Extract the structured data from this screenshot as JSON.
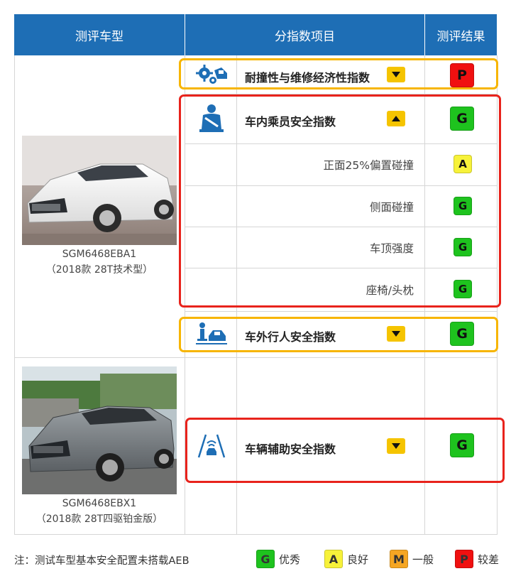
{
  "header": {
    "col_model": "测评车型",
    "col_item": "分指数项目",
    "col_result": "测评结果"
  },
  "colors": {
    "header_blue": "#1e6eb5",
    "grade_G": "#1ec31e",
    "grade_A": "#f7f23a",
    "grade_M": "#f5a623",
    "grade_P": "#f01010",
    "highlight_orange": "#f7b500",
    "highlight_red": "#e8231c",
    "toggle_yellow": "#f5c400"
  },
  "vehicles": [
    {
      "code": "SGM6468EBA1",
      "trim": "（2018款 28T技术型）"
    },
    {
      "code": "SGM6468EBX1",
      "trim": "（2018款 28T四驱铂金版）"
    }
  ],
  "indices": {
    "crash_repair": {
      "icon": "repair-gears-icon",
      "label": "耐撞性与维修经济性指数",
      "toggle": "collapsed",
      "grade": "P"
    },
    "occupant": {
      "icon": "seated-occupant-icon",
      "label": "车内乘员安全指数",
      "toggle": "expanded",
      "grade": "G",
      "sub_items": [
        {
          "label": "正面25%偏置碰撞",
          "grade": "A"
        },
        {
          "label": "侧面碰撞",
          "grade": "G"
        },
        {
          "label": "车顶强度",
          "grade": "G"
        },
        {
          "label": "座椅/头枕",
          "grade": "G"
        }
      ]
    },
    "pedestrian": {
      "icon": "pedestrian-car-icon",
      "label": "车外行人安全指数",
      "toggle": "collapsed",
      "grade": "G"
    },
    "assist": {
      "icon": "lane-assist-icon",
      "label": "车辆辅助安全指数",
      "toggle": "collapsed",
      "grade": "G"
    }
  },
  "footer": {
    "note": "注：测试车型基本安全配置未搭载AEB",
    "legend": [
      {
        "grade": "G",
        "label": "优秀"
      },
      {
        "grade": "A",
        "label": "良好"
      },
      {
        "grade": "M",
        "label": "一般"
      },
      {
        "grade": "P",
        "label": "较差"
      }
    ]
  }
}
